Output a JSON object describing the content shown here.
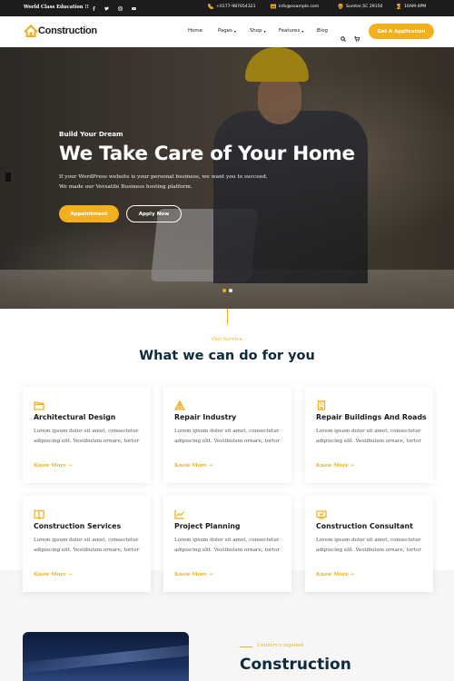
{
  "topbar": {
    "tagline": "World Class Education !!",
    "social": [
      "facebook-icon",
      "twitter-icon",
      "instagram-icon",
      "youtube-icon"
    ],
    "phone": "+0177-987654321",
    "email": "info@example.com",
    "location": "Sumter,SC 29150",
    "hours": "10AM-4PM"
  },
  "header": {
    "logo_text": "Construction",
    "nav": [
      {
        "label": "Home",
        "has_dropdown": false
      },
      {
        "label": "Pages",
        "has_dropdown": true
      },
      {
        "label": "Shop",
        "has_dropdown": true
      },
      {
        "label": "Features",
        "has_dropdown": true
      },
      {
        "label": "Blog",
        "has_dropdown": false
      }
    ],
    "cta_label": "Get A Application"
  },
  "hero": {
    "subtitle": "Build Your Dream",
    "title": "We Take Care of Your Home",
    "description": "If your WordPress website is your personal business, we want you to succeed. We made our Versatile Business hosting platform.",
    "primary_button": "Appointment",
    "secondary_button": "Apply Now",
    "slider_dots": 2,
    "active_dot": 0
  },
  "services": {
    "eyebrow": "Our Service",
    "title": "What we can do for you",
    "cards": [
      {
        "icon": "folder-icon",
        "title": "Architectural Design",
        "text": "Lorem ipsum dolor sit amet, consectetur adipiscing elit. Vestibulum ornare, tortor",
        "link": "Know More →"
      },
      {
        "icon": "structure-icon",
        "title": "Repair Industry",
        "text": "Lorem ipsum dolor sit amet, consectetur adipiscing elit. Vestibulum ornare, tortor",
        "link": "Know More →"
      },
      {
        "icon": "building-icon",
        "title": "Repair Buildings And Roads",
        "text": "Lorem ipsum dolor sit amet, consectetur adipiscing elit. Vestibulum ornare, tortor",
        "link": "Know More →"
      },
      {
        "icon": "book-icon",
        "title": "Construction Services",
        "text": "Lorem ipsum dolor sit amet, consectetur adipiscing elit. Vestibulum ornare, tortor",
        "link": "Know More →"
      },
      {
        "icon": "chart-icon",
        "title": "Project Planning",
        "text": "Lorem ipsum dolor sit amet, consectetur adipiscing elit. Vestibulum ornare, tortor",
        "link": "Know More →"
      },
      {
        "icon": "consultant-icon",
        "title": "Construction Consultant",
        "text": "Lorem ipsum dolor sit amet, consectetur adipiscing elit. Vestibulum ornare, tortor",
        "link": "Know More →"
      }
    ]
  },
  "teaser": {
    "eyebrow": "Country's reputed",
    "title": "Construction"
  },
  "colors": {
    "accent": "#f2b01e",
    "heading": "#0f2a3d",
    "topbar": "#1c1c1c"
  }
}
